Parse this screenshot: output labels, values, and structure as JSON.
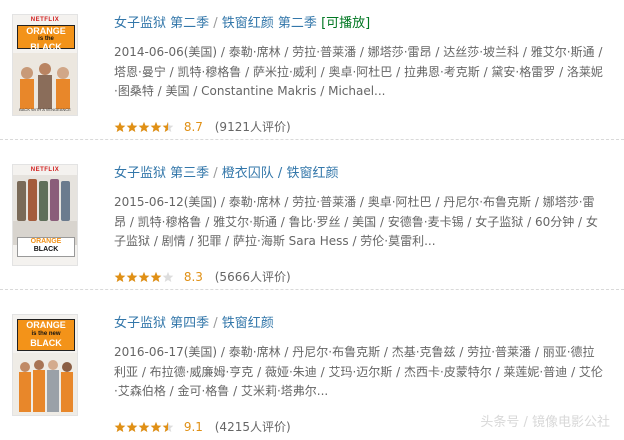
{
  "items": [
    {
      "poster": {
        "brand": "NETFLIX",
        "logo_line1": "ORANGE",
        "logo_line2": "is the",
        "logo_line3": "BLACK",
        "tagline": "BACK WITH A VENGEANCE",
        "theme": "#f39319"
      },
      "title": "女子监狱 第二季",
      "aka": "铁窗红颜 第二季",
      "extra": "[可播放]",
      "meta": "2014-06-06(美国) / 泰勒·席林 / 劳拉·普莱潘 / 娜塔莎·雷昂 / 达丝莎·坡兰科 / 雅艾尔·斯通 / 塔恩·曼宁 / 凯特·穆格鲁 / 萨米拉·威利 / 奥卓·阿杜巴 / 拉弗恩·考克斯 / 黛安·格雷罗 / 洛莱妮·图桑特 / 美国 / Constantine Makris / Michael...",
      "rating": 4.5,
      "score": "8.7",
      "count": "(9121人评价)"
    },
    {
      "poster": {
        "brand": "NETFLIX",
        "logo_line1": "ORANGE",
        "logo_line2": "is the",
        "logo_line3": "BLACK",
        "tagline": "",
        "theme": "#f39319"
      },
      "title": "女子监狱 第三季",
      "aka": "橙衣囚队 / 铁窗红颜",
      "extra": "",
      "meta": "2015-06-12(美国) / 泰勒·席林 / 劳拉·普莱潘 / 奥卓·阿杜巴 / 丹尼尔·布鲁克斯 / 娜塔莎·雷昂 / 凯特·穆格鲁 / 雅艾尔·斯通 / 鲁比·罗丝 / 美国 / 安德鲁·麦卡锡 / 女子监狱 / 60分钟 / 女子监狱 / 剧情 / 犯罪 / 萨拉·海斯 Sara Hess / 劳伦·莫雷利...",
      "rating": 4.0,
      "score": "8.3",
      "count": "(5666人评价)"
    },
    {
      "poster": {
        "brand": "",
        "logo_line1": "ORANGE",
        "logo_line2": "is the new",
        "logo_line3": "BLACK",
        "tagline": "",
        "theme": "#f39319"
      },
      "title": "女子监狱 第四季",
      "aka": "铁窗红颜",
      "extra": "",
      "meta": "2016-06-17(美国) / 泰勒·席林 / 丹尼尔·布鲁克斯 / 杰基·克鲁兹 / 劳拉·普莱潘 / 丽亚·德拉利亚 / 布拉德·威廉姆·亨克 / 薇娅·朱迪 / 艾玛·迈尔斯 / 杰西卡·皮蒙特尔 / 莱莲妮·普迪 / 艾伦·艾森伯格 / 金可·格鲁 / 艾米莉·塔弗尔...",
      "rating": 4.5,
      "score": "9.1",
      "count": "(4215人评价)"
    }
  ],
  "watermark": "头条号 / 镜像电影公社",
  "colors": {
    "link": "#3377aa",
    "playable": "#007722",
    "star": "#e09015",
    "meta": "#666666"
  }
}
